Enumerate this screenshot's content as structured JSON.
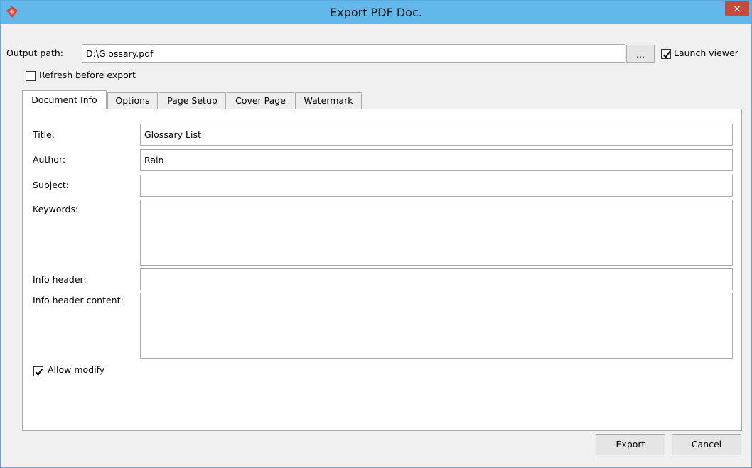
{
  "window": {
    "title": "Export PDF Doc.",
    "close_glyph": "×",
    "accent": "#62b8ea"
  },
  "output": {
    "label": "Output path:",
    "value": "D:\\Glossary.pdf",
    "browse_label": "...",
    "launch_viewer_label": "Launch viewer",
    "launch_viewer_checked": true
  },
  "refresh": {
    "label": "Refresh before export",
    "checked": false
  },
  "tabs": [
    {
      "label": "Document Info",
      "active": true
    },
    {
      "label": "Options",
      "active": false
    },
    {
      "label": "Page Setup",
      "active": false
    },
    {
      "label": "Cover Page",
      "active": false
    },
    {
      "label": "Watermark",
      "active": false
    }
  ],
  "doc_info": {
    "title_label": "Title:",
    "title_value": "Glossary List",
    "author_label": "Author:",
    "author_value": "Rain",
    "subject_label": "Subject:",
    "subject_value": "",
    "keywords_label": "Keywords:",
    "keywords_value": "",
    "info_header_label": "Info header:",
    "info_header_value": "",
    "info_header_content_label": "Info header content:",
    "info_header_content_value": "",
    "allow_modify_label": "Allow modify",
    "allow_modify_checked": true
  },
  "footer": {
    "export_label": "Export",
    "cancel_label": "Cancel"
  }
}
